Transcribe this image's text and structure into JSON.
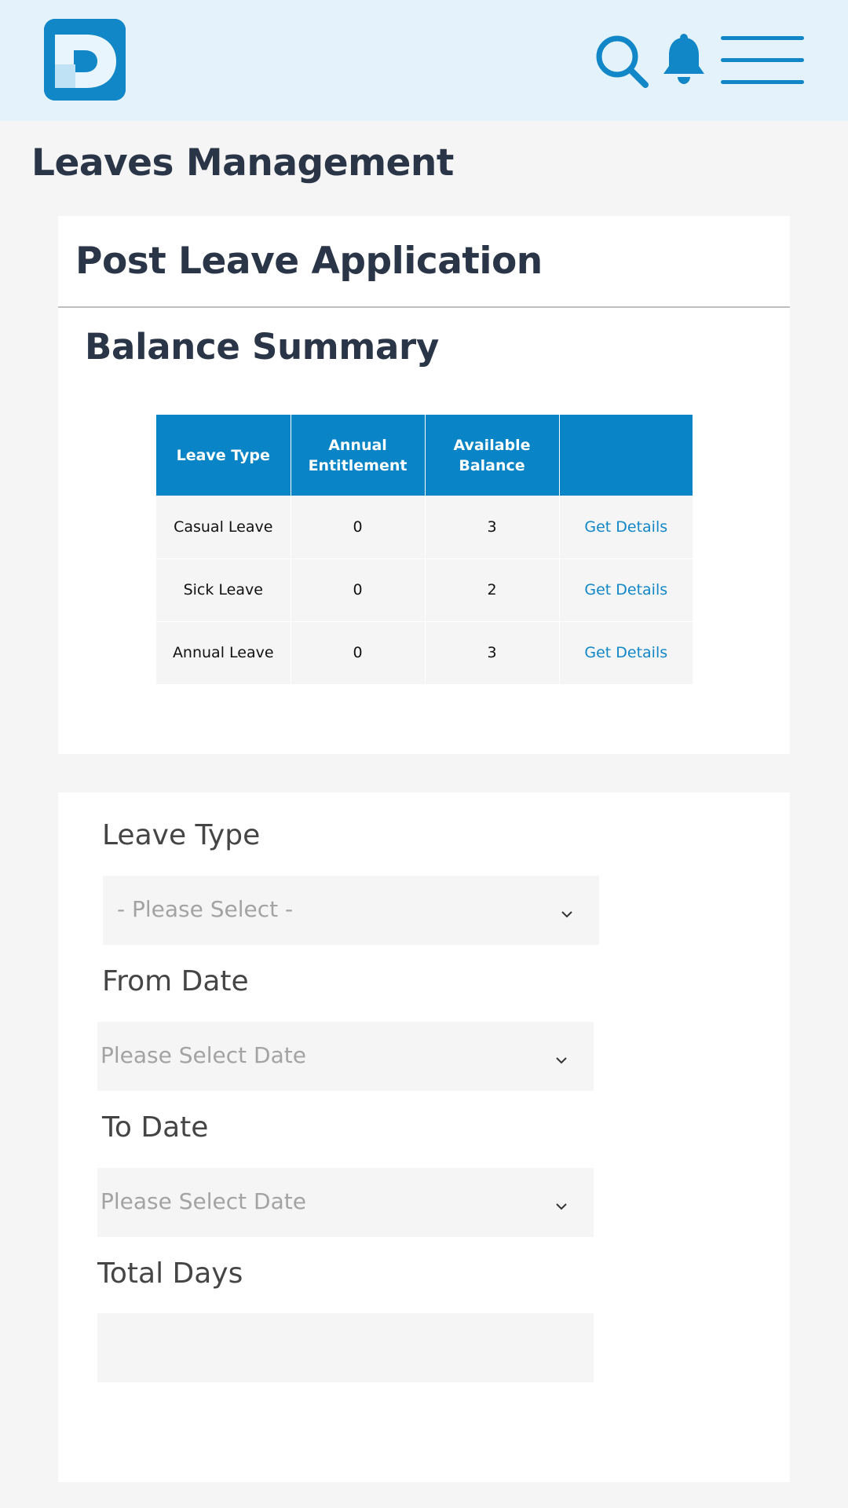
{
  "header": {
    "logo_letter": "D",
    "brand_color": "#1187c7",
    "icons": [
      "search-icon",
      "bell-icon",
      "hamburger-menu-icon"
    ]
  },
  "page": {
    "title": "Leaves Management"
  },
  "application_card": {
    "title": "Post Leave Application",
    "balance_section_title": "Balance Summary",
    "table": {
      "headers": [
        "Leave Type",
        "Annual Entitlement",
        "Available Balance",
        ""
      ],
      "rows": [
        {
          "leave_type": "Casual Leave",
          "annual_entitlement": "0",
          "available_balance": "3",
          "action": "Get Details"
        },
        {
          "leave_type": "Sick Leave",
          "annual_entitlement": "0",
          "available_balance": "2",
          "action": "Get Details"
        },
        {
          "leave_type": "Annual Leave",
          "annual_entitlement": "0",
          "available_balance": "3",
          "action": "Get Details"
        }
      ],
      "header_color": "#0984c6"
    }
  },
  "form": {
    "leave_type": {
      "label": "Leave Type",
      "placeholder": "- Please Select -"
    },
    "from_date": {
      "label": "From Date",
      "placeholder": "Please Select Date"
    },
    "to_date": {
      "label": "To Date",
      "placeholder": "Please Select Date"
    },
    "total_days": {
      "label": "Total Days",
      "value": ""
    }
  }
}
